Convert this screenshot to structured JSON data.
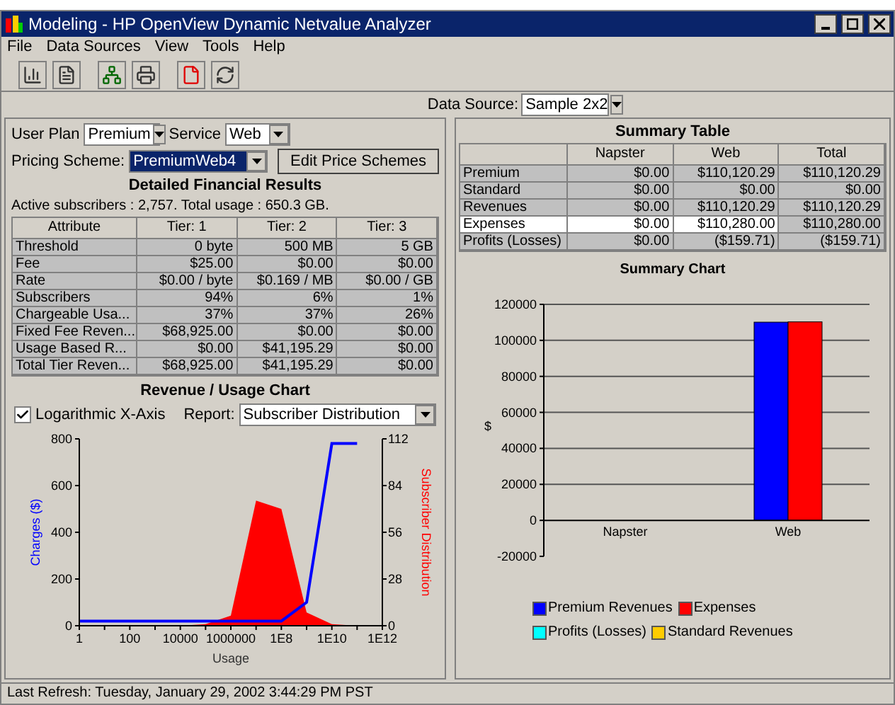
{
  "window": {
    "title": "Modeling - HP OpenView Dynamic Netvalue Analyzer"
  },
  "menu": [
    "File",
    "Data Sources",
    "View",
    "Tools",
    "Help"
  ],
  "data_source": {
    "label": "Data Source:",
    "value": "Sample 2x2"
  },
  "left": {
    "user_plan": {
      "label": "User Plan",
      "value": "Premium"
    },
    "service": {
      "label": "Service",
      "value": "Web"
    },
    "pricing_scheme": {
      "label": "Pricing Scheme:",
      "value": "PremiumWeb4"
    },
    "edit_button": "Edit Price Schemes",
    "results": {
      "title": "Detailed Financial Results",
      "summary": "Active subscribers : 2,757. Total usage : 650.3 GB.",
      "columns": [
        "Attribute",
        "Tier: 1",
        "Tier: 2",
        "Tier: 3"
      ],
      "rows": [
        [
          "Threshold",
          "0 byte",
          "500 MB",
          "5 GB"
        ],
        [
          "Fee",
          "$25.00",
          "$0.00",
          "$0.00"
        ],
        [
          "Rate",
          "$0.00 / byte",
          "$0.169 / MB",
          "$0.00 / GB"
        ],
        [
          "Subscribers",
          "94%",
          "6%",
          "1%"
        ],
        [
          "Chargeable Usa...",
          "37%",
          "37%",
          "26%"
        ],
        [
          "Fixed Fee Reven...",
          "$68,925.00",
          "$0.00",
          "$0.00"
        ],
        [
          "Usage Based R...",
          "$0.00",
          "$41,195.29",
          "$0.00"
        ],
        [
          "Total Tier Reven...",
          "$68,925.00",
          "$41,195.29",
          "$0.00"
        ]
      ]
    },
    "revenue_chart": {
      "title": "Revenue / Usage Chart",
      "log_axis": {
        "label": "Logarithmic X-Axis",
        "checked": true
      },
      "report": {
        "label": "Report:",
        "value": "Subscriber Distribution"
      },
      "chart_data": {
        "type": "line",
        "xlabel": "Usage",
        "categories": [
          "1",
          null,
          "100",
          null,
          "10000",
          null,
          "1000000",
          null,
          "1E8",
          null,
          "1E10",
          null,
          "1E12"
        ],
        "ylim": [
          0,
          800
        ],
        "yticks": [
          0,
          200,
          400,
          600,
          800
        ],
        "y2lim": [
          0,
          112
        ],
        "y2ticks": [
          0,
          28,
          56,
          84,
          112
        ],
        "series": [
          {
            "name": "Charges ($)",
            "color": "#0000ff",
            "values": [
              20,
              20,
              20,
              20,
              20,
              20,
              20,
              20,
              20,
              100,
              780,
              780,
              null
            ]
          },
          {
            "name": "Subscriber Distribution",
            "color": "#ff0000",
            "axis": "y2",
            "type": "area",
            "values": [
              0,
              0,
              0,
              0,
              0,
              1,
              6,
              75,
              70,
              8,
              1,
              0,
              0
            ]
          }
        ]
      }
    }
  },
  "right": {
    "summary_table": {
      "title": "Summary Table",
      "columns": [
        "",
        "Napster",
        "Web",
        "Total"
      ],
      "rows": [
        {
          "cells": [
            "Premium",
            "$0.00",
            "$110,120.29",
            "$110,120.29"
          ],
          "selected": false
        },
        {
          "cells": [
            "Standard",
            "$0.00",
            "$0.00",
            "$0.00"
          ],
          "selected": false
        },
        {
          "cells": [
            "Revenues",
            "$0.00",
            "$110,120.29",
            "$110,120.29"
          ],
          "selected": false
        },
        {
          "cells": [
            "Expenses",
            "$0.00",
            "$110,280.00",
            "$110,280.00"
          ],
          "selected": true
        },
        {
          "cells": [
            "Profits (Losses)",
            "$0.00",
            "($159.71)",
            "($159.71)"
          ],
          "selected": false
        }
      ]
    },
    "summary_chart": {
      "chart_data": {
        "type": "bar",
        "title": "Summary Chart",
        "grid": true,
        "ylabel": "$",
        "categories": [
          "Napster",
          "Web"
        ],
        "ylim": [
          -20000,
          120000
        ],
        "yticks": [
          -20000,
          0,
          20000,
          40000,
          60000,
          80000,
          100000,
          120000
        ],
        "series": [
          {
            "name": "Premium Revenues",
            "color": "#0000ff",
            "values": [
              0,
              110120
            ]
          },
          {
            "name": "Expenses",
            "color": "#ff0000",
            "values": [
              0,
              110280
            ]
          },
          {
            "name": "Profits (Losses)",
            "color": "#00ffff",
            "values": [
              0,
              null
            ]
          },
          {
            "name": "Standard Revenues",
            "color": "#ffcc00",
            "values": [
              0,
              0
            ]
          }
        ]
      }
    }
  },
  "status_bar": "Last Refresh: Tuesday, January 29, 2002 3:44:29 PM PST"
}
